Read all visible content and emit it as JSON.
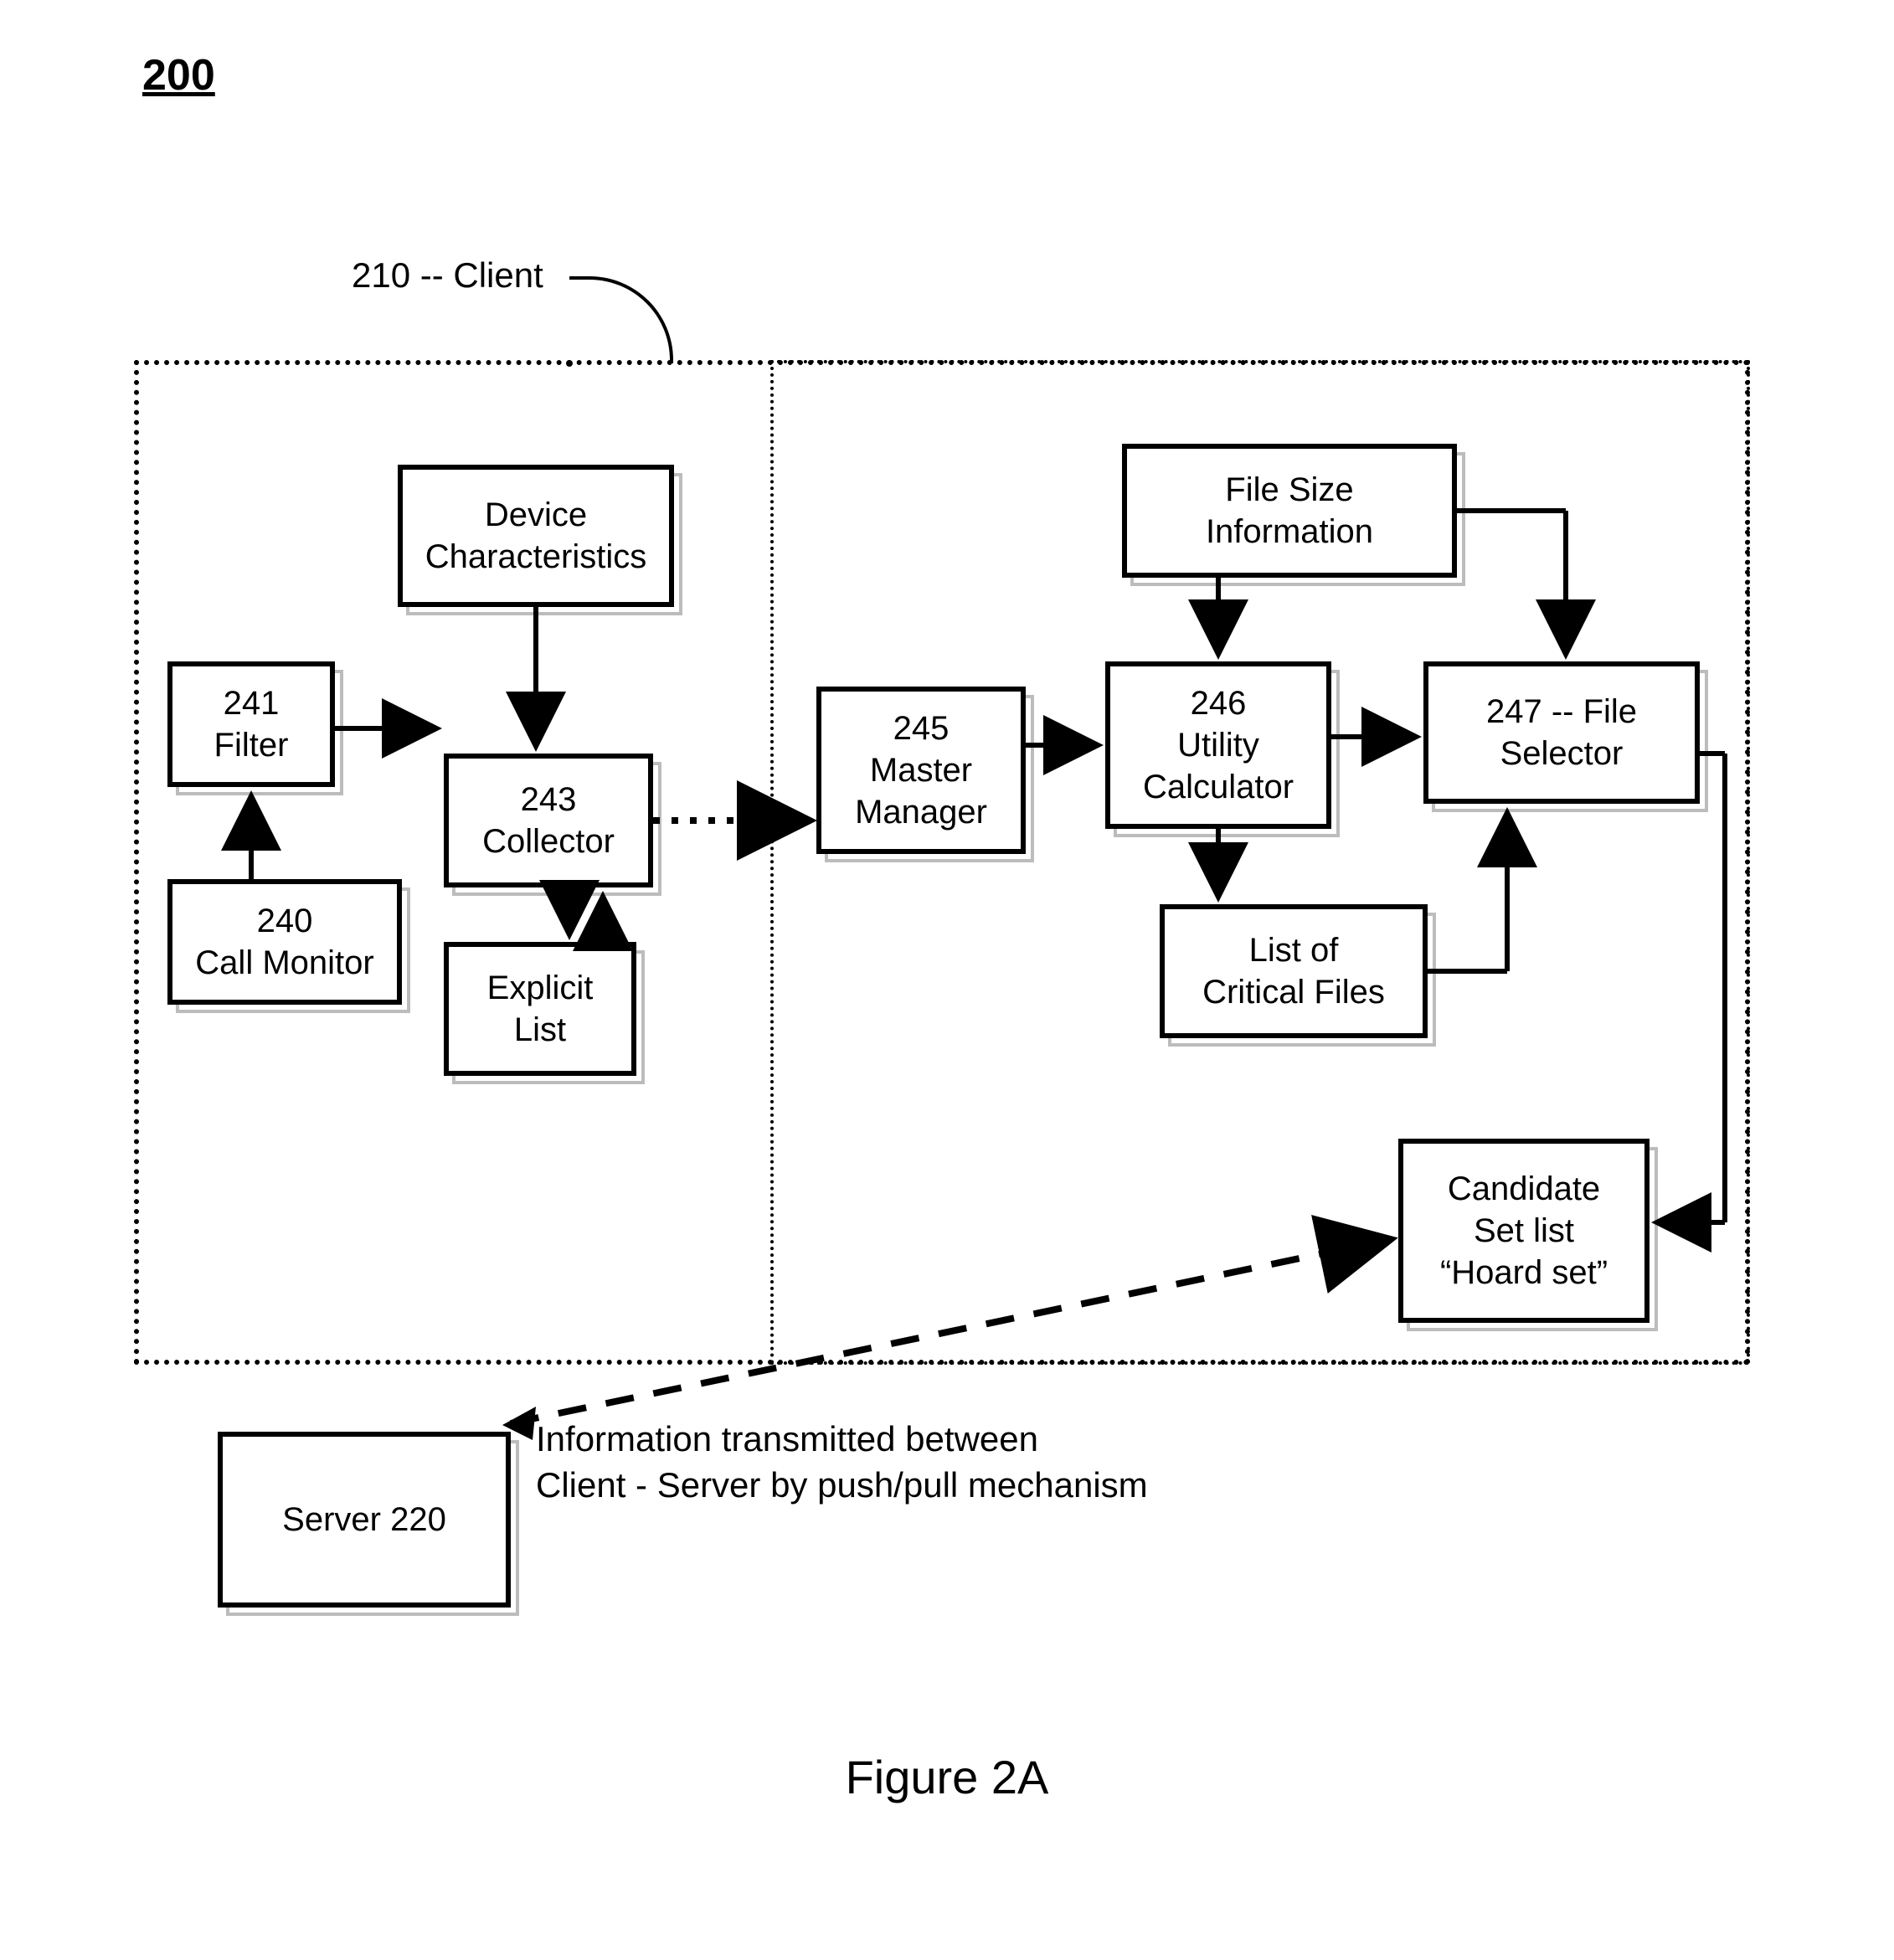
{
  "figure": {
    "number": "200",
    "caption": "Figure 2A"
  },
  "client": {
    "ref": "210",
    "label": "Client"
  },
  "server": {
    "ref": "220",
    "label": "Server 220"
  },
  "boxes": {
    "filter": {
      "ref": "241",
      "label": "Filter"
    },
    "call_monitor": {
      "ref": "240",
      "label": "Call Monitor"
    },
    "device_chars": {
      "label": "Device\nCharacteristics"
    },
    "collector": {
      "ref": "243",
      "label": "Collector"
    },
    "explicit_list": {
      "label": "Explicit\nList"
    },
    "master_manager": {
      "ref": "245",
      "label": "Master\nManager"
    },
    "utility_calc": {
      "ref": "246",
      "label": "Utility\nCalculator"
    },
    "file_size_info": {
      "label": "File Size\nInformation"
    },
    "file_selector": {
      "ref": "247",
      "label": "File\nSelector",
      "sep": " -- "
    },
    "critical_files": {
      "label": "List of\nCritical Files"
    },
    "hoard_set": {
      "label": "Candidate\nSet list\n“Hoard set”"
    }
  },
  "note": {
    "line1": "Information transmitted between",
    "line2": "Client - Server by push/pull mechanism"
  }
}
